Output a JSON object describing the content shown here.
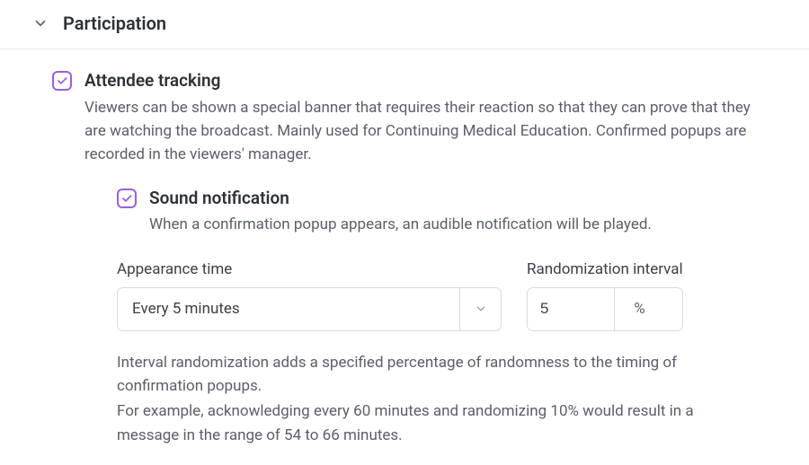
{
  "section": {
    "title": "Participation"
  },
  "attendee": {
    "title": "Attendee tracking",
    "desc": "Viewers can be shown a special banner that requires their reaction so that they can prove that they are watching the broadcast. Mainly used for Continuing Medical Education. Confirmed popups are recorded in the viewers' manager.",
    "checked": true
  },
  "sound": {
    "title": "Sound notification",
    "desc": "When a confirmation popup appears, an audible notification will be played.",
    "checked": true
  },
  "appearance": {
    "label": "Appearance time",
    "value": "Every 5 minutes"
  },
  "randomization": {
    "label": "Randomization interval",
    "value": "5",
    "suffix": "%"
  },
  "footnote": {
    "p1": "Interval randomization adds a specified percentage of randomness to the timing of confirmation popups.",
    "p2": "For example, acknowledging every 60 minutes and randomizing 10% would result in a message in the range of 54 to 66 minutes."
  }
}
